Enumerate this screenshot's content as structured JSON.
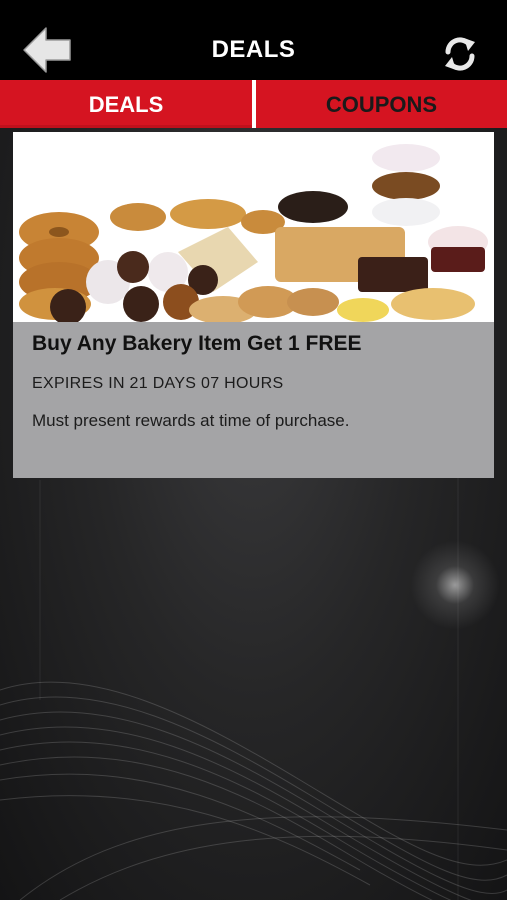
{
  "header": {
    "title": "DEALS",
    "back_icon": "back-arrow-icon",
    "refresh_icon": "refresh-icon"
  },
  "tabs": [
    {
      "label": "DEALS",
      "active": true
    },
    {
      "label": "COUPONS",
      "active": false
    }
  ],
  "deals": [
    {
      "image": "bakery-items-photo",
      "title": "Buy Any Bakery Item Get 1 FREE",
      "expires": "EXPIRES IN 21 DAYS 07 HOURS",
      "description": "Must present rewards at time of purchase."
    }
  ],
  "colors": {
    "header_bg": "#000000",
    "tab_red": "#d51421",
    "card_bg": "#a4a4a6"
  }
}
